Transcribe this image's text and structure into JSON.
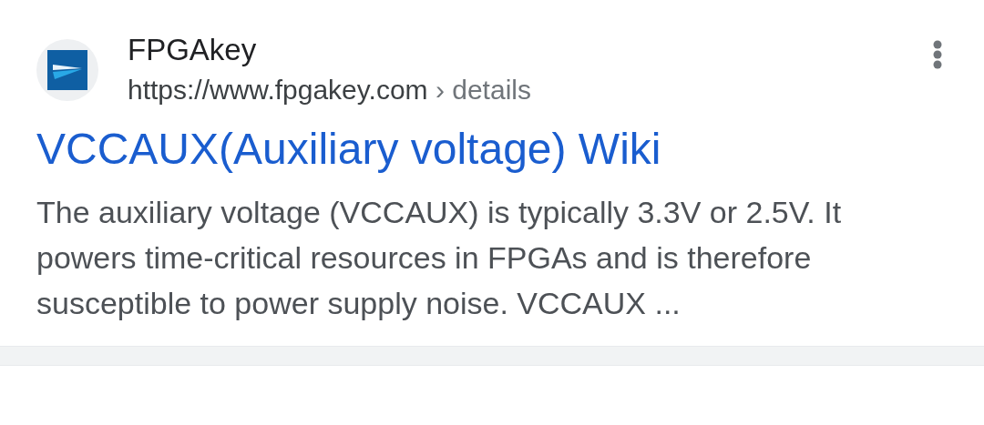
{
  "result": {
    "site_name": "FPGAkey",
    "url": "https://www.fpgakey.com",
    "breadcrumb": "› details",
    "title": "VCCAUX(Auxiliary voltage) Wiki",
    "snippet": "The auxiliary voltage (VCCAUX) is typically 3.3V or 2.5V. It powers time-critical resources in FPGAs and is therefore susceptible to power supply noise. VCCAUX ..."
  }
}
